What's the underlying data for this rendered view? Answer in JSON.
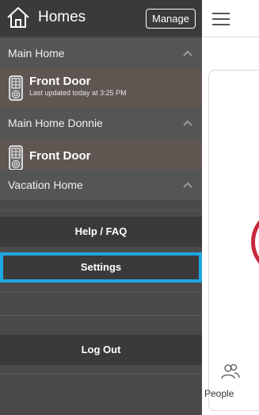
{
  "sidebar": {
    "title": "Homes",
    "manage_label": "Manage",
    "groups": [
      {
        "name": "Main Home",
        "locks": [
          {
            "name": "Front Door",
            "status": "Last updated today at 3:25 PM"
          }
        ]
      },
      {
        "name": "Main Home Donnie",
        "locks": [
          {
            "name": "Front Door",
            "status": ""
          }
        ]
      },
      {
        "name": "Vacation Home",
        "locks": []
      }
    ],
    "buttons": {
      "help": "Help / FAQ",
      "settings": "Settings",
      "logout": "Log Out"
    }
  },
  "main": {
    "tab_people_label": "People"
  },
  "colors": {
    "sidebar_bg": "#4a4a4a",
    "header_bg": "#3a3a3a",
    "lock_row_bg": "#5f5651",
    "selection_outline": "#1ea7e1",
    "accent_red": "#c8283c"
  },
  "icons": {
    "header": "home-icon",
    "lock": "keypad-lock-icon",
    "group_toggle": "chevron-up-icon",
    "menu": "hamburger-icon",
    "people": "people-icon"
  }
}
